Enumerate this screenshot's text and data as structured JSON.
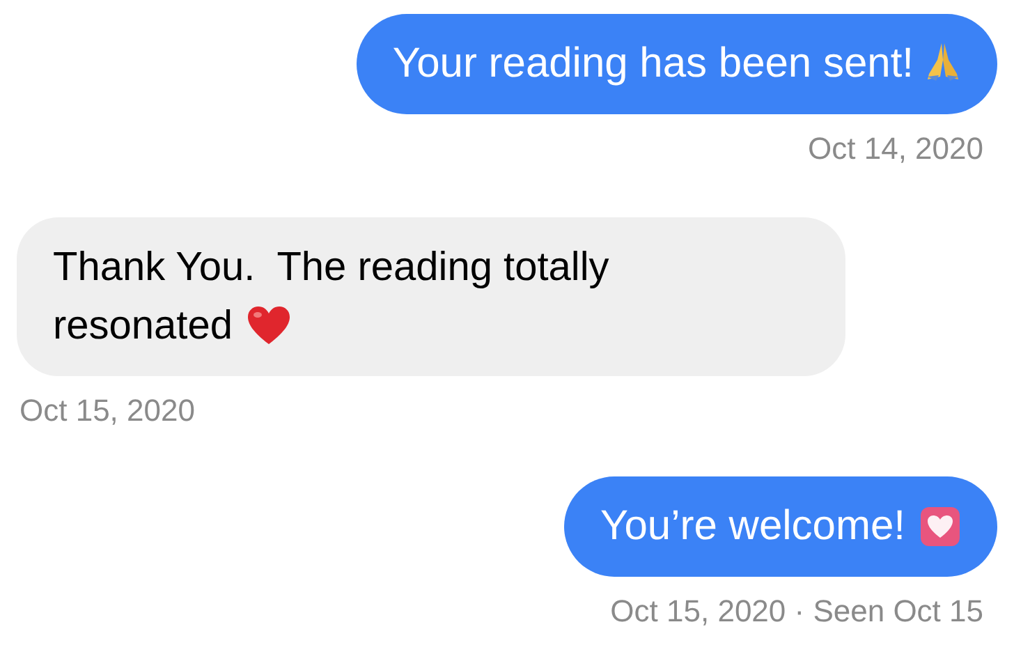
{
  "messages": [
    {
      "kind": "sent",
      "text": "Your reading has been sent!",
      "timestamp": "Oct 14, 2020"
    },
    {
      "kind": "received",
      "text": "Thank You.  The reading totally resonated",
      "timestamp": "Oct 15, 2020"
    },
    {
      "kind": "sent",
      "text": "You’re welcome!",
      "timestamp": "Oct 15, 2020 · Seen Oct 15"
    }
  ]
}
